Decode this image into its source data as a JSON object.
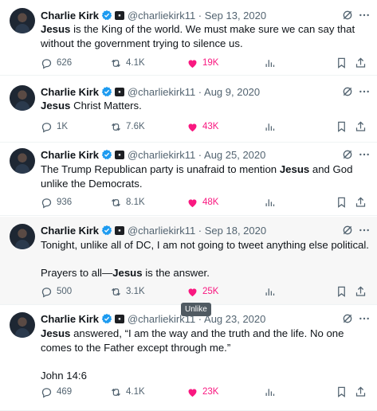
{
  "colors": {
    "like": "#f91880",
    "muted": "#536471",
    "verified": "#1d9bf0"
  },
  "tooltip": "Unlike",
  "tweets": [
    {
      "name": "Charlie Kirk",
      "handle_date": "@charliekirk11 · Sep 13, 2020",
      "text_html": "<b>Jesus</b> is the King of the world. We must make sure we can say that without the government trying to silence us.",
      "replies": "626",
      "reposts": "4.1K",
      "likes": "19K"
    },
    {
      "name": "Charlie Kirk",
      "handle_date": "@charliekirk11 · Aug 9, 2020",
      "text_html": "<b>Jesus</b> Christ Matters.",
      "replies": "1K",
      "reposts": "7.6K",
      "likes": "43K"
    },
    {
      "name": "Charlie Kirk",
      "handle_date": "@charliekirk11 · Aug 25, 2020",
      "text_html": "The Trump Republican party is unafraid to mention <b>Jesus</b> and God unlike the Democrats.",
      "replies": "936",
      "reposts": "8.1K",
      "likes": "48K"
    },
    {
      "name": "Charlie Kirk",
      "handle_date": "@charliekirk11 · Sep 18, 2020",
      "text_html": "Tonight, unlike all of DC, I am not going to tweet anything else political.<br><br>Prayers to all—<b>Jesus</b> is the answer.",
      "replies": "500",
      "reposts": "3.1K",
      "likes": "25K"
    },
    {
      "name": "Charlie Kirk",
      "handle_date": "@charliekirk11 · Aug 23, 2020",
      "text_html": "<b>Jesus</b> answered, “I am the way and the truth and the life. No one comes to the Father except through me.”<br><br>John 14:6",
      "replies": "469",
      "reposts": "4.1K",
      "likes": "23K"
    }
  ]
}
